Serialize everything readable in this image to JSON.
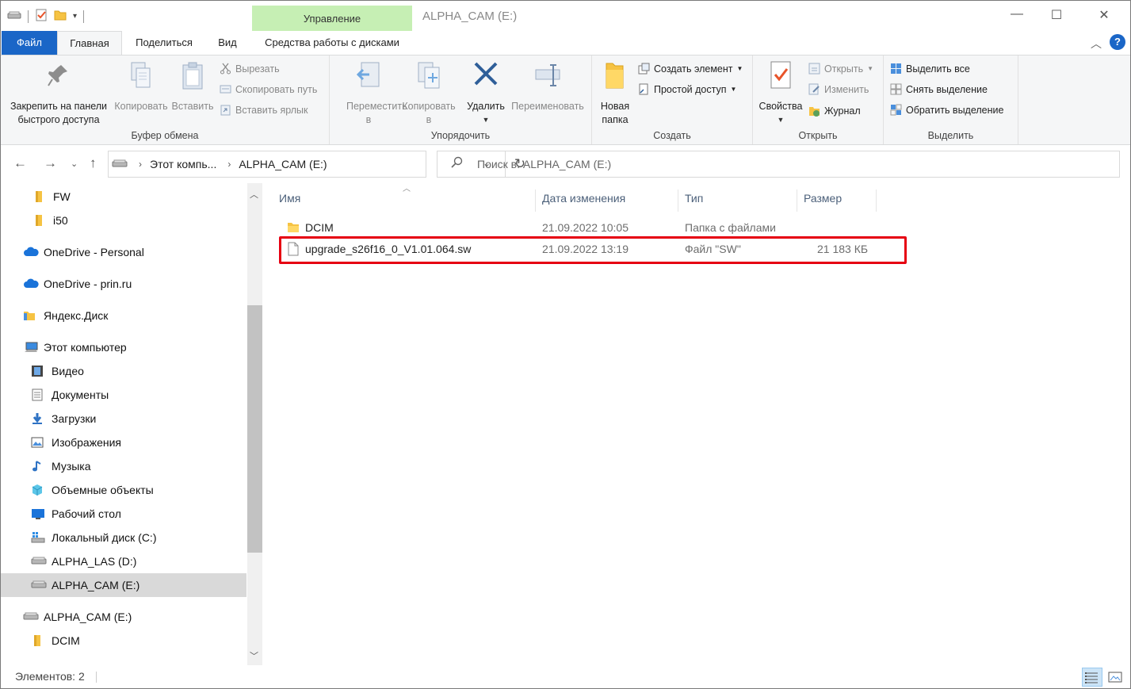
{
  "titlebar": {
    "context_tab": "Управление",
    "title": "ALPHA_CAM (E:)"
  },
  "tabs": [
    "Файл",
    "Главная",
    "Поделиться",
    "Вид",
    "Средства работы с дисками"
  ],
  "ribbon": {
    "clipboard": {
      "label": "Буфер обмена",
      "pin": "Закрепить на панели быстрого доступа",
      "copy": "Копировать",
      "paste": "Вставить",
      "cut": "Вырезать",
      "copy_path": "Скопировать путь",
      "paste_shortcut": "Вставить ярлык"
    },
    "organize": {
      "label": "Упорядочить",
      "move_to": "Переместить в",
      "copy_to": "Копировать в",
      "delete": "Удалить",
      "rename": "Переименовать"
    },
    "create": {
      "label": "Создать",
      "new_folder": "Новая папка",
      "new_item": "Создать элемент",
      "easy_access": "Простой доступ"
    },
    "open": {
      "label": "Открыть",
      "properties": "Свойства",
      "open": "Открыть",
      "edit": "Изменить",
      "history": "Журнал"
    },
    "select": {
      "label": "Выделить",
      "select_all": "Выделить все",
      "select_none": "Снять выделение",
      "invert": "Обратить выделение"
    }
  },
  "address": {
    "crumb1": "Этот компь...",
    "crumb2": "ALPHA_CAM (E:)",
    "search_placeholder": "Поиск в: ALPHA_CAM (E:)"
  },
  "nav": {
    "items": [
      {
        "label": "FW",
        "icon": "folder-icon"
      },
      {
        "label": "i50",
        "icon": "folder-icon"
      },
      {
        "label": "OneDrive - Personal",
        "icon": "cloud-icon"
      },
      {
        "label": "OneDrive - prin.ru",
        "icon": "cloud-icon"
      },
      {
        "label": "Яндекс.Диск",
        "icon": "yandex-disk-icon"
      },
      {
        "label": "Этот компьютер",
        "icon": "computer-icon"
      },
      {
        "label": "Видео",
        "icon": "video-icon"
      },
      {
        "label": "Документы",
        "icon": "documents-icon"
      },
      {
        "label": "Загрузки",
        "icon": "download-icon"
      },
      {
        "label": "Изображения",
        "icon": "pictures-icon"
      },
      {
        "label": "Музыка",
        "icon": "music-icon"
      },
      {
        "label": "Объемные объекты",
        "icon": "3d-objects-icon"
      },
      {
        "label": "Рабочий стол",
        "icon": "desktop-icon"
      },
      {
        "label": "Локальный диск (C:)",
        "icon": "windows-drive-icon"
      },
      {
        "label": "ALPHA_LAS (D:)",
        "icon": "drive-icon"
      },
      {
        "label": "ALPHA_CAM (E:)",
        "icon": "drive-icon"
      },
      {
        "label": "ALPHA_CAM (E:)",
        "icon": "drive-icon"
      },
      {
        "label": "DCIM",
        "icon": "folder-icon"
      }
    ]
  },
  "columns": {
    "name": "Имя",
    "modified": "Дата изменения",
    "type": "Тип",
    "size": "Размер"
  },
  "files": [
    {
      "name": "DCIM",
      "modified": "21.09.2022 10:05",
      "type": "Папка с файлами",
      "size": "",
      "icon": "folder-icon"
    },
    {
      "name": "upgrade_s26f16_0_V1.01.064.sw",
      "modified": "21.09.2022 13:19",
      "type": "Файл \"SW\"",
      "size": "21 183 КБ",
      "icon": "file-icon"
    }
  ],
  "status": {
    "items_count": "Элементов: 2"
  },
  "colors": {
    "accent": "#1a66c7",
    "context_tab": "#c6efb4",
    "highlight": "#e60012",
    "selection": "#d9d9d9"
  }
}
